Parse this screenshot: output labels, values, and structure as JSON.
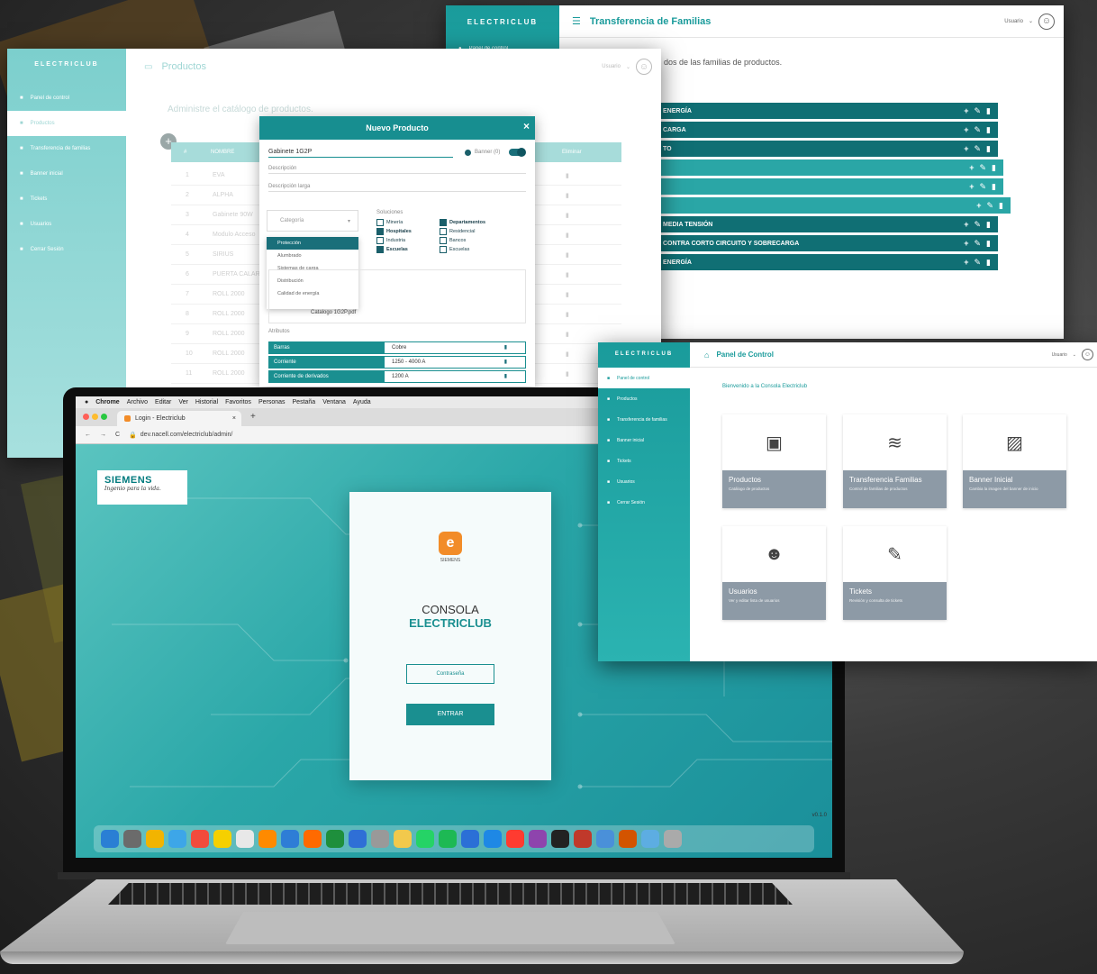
{
  "colors": {
    "teal": "#1a9b9b",
    "dark_teal": "#106f74",
    "card_gray": "#8d9aa6",
    "siemens": "#009999",
    "orange": "#f28c28"
  },
  "families_window": {
    "brand": "ELECTRICLUB",
    "title": "Transferencia de Familias",
    "user": "Usuario",
    "sidebar_first": "Panel de control",
    "subtitle": "dos de las familias de productos.",
    "rows": [
      "ENERGÍA",
      "CARGA",
      "TO",
      "",
      "",
      "",
      "MEDIA TENSIÓN",
      "CONTRA CORTO CIRCUITO Y SOBRECARGA",
      "ENERGÍA"
    ],
    "actions": "+ ✎ 🗑"
  },
  "products_window": {
    "brand": "ELECTRICLUB",
    "title": "Productos",
    "user": "Usuario",
    "subtitle": "Administre el catálogo de productos.",
    "sidebar": [
      "Panel de control",
      "Productos",
      "Transferencia de familias",
      "Banner inicial",
      "Tickets",
      "Usuarios",
      "Cerrar Sesión"
    ],
    "table_headers": [
      "#",
      "NOMBRE",
      "Editar",
      "Eliminar"
    ],
    "rows": [
      {
        "n": "1",
        "name": "EVA"
      },
      {
        "n": "2",
        "name": "ALPHA"
      },
      {
        "n": "3",
        "name": "Gabinete 90W"
      },
      {
        "n": "4",
        "name": "Modulo Acceso"
      },
      {
        "n": "5",
        "name": "SIRIUS"
      },
      {
        "n": "6",
        "name": "PUERTA CALAR"
      },
      {
        "n": "7",
        "name": "ROLL 2000"
      },
      {
        "n": "8",
        "name": "ROLL 2000"
      },
      {
        "n": "9",
        "name": "ROLL 2000"
      },
      {
        "n": "10",
        "name": "ROLL 2000"
      },
      {
        "n": "11",
        "name": "ROLL 2000"
      }
    ]
  },
  "modal": {
    "title": "Nuevo Producto",
    "close": "×",
    "name_value": "Gabinete 1G2P",
    "toggle_label": "Banner (0)",
    "description": "Descripción",
    "long_description": "Descripción larga",
    "category_placeholder": "Categoría",
    "category_options": [
      "Protección",
      "Alumbrado",
      "Sistemas de carga",
      "Distribución",
      "Calidad de energía"
    ],
    "solutions_label": "Soluciones",
    "solutions": [
      {
        "label": "Minería",
        "checked": false
      },
      {
        "label": "Departamentos",
        "checked": true
      },
      {
        "label": "Hospitales",
        "checked": true
      },
      {
        "label": "Residencial",
        "checked": false
      },
      {
        "label": "Industria",
        "checked": false
      },
      {
        "label": "Bancos",
        "checked": false
      },
      {
        "label": "Escuelas",
        "checked": true
      },
      {
        "label": "Escuelas",
        "checked": false
      }
    ],
    "catalog_label": "Catalogo 1G2P.pdf",
    "attributes_label": "Atributos",
    "attributes": [
      {
        "key": "Barras",
        "value": "Cobre"
      },
      {
        "key": "Corriente",
        "value": "1250 - 4000 A"
      },
      {
        "key": "Corriente de derivados",
        "value": "1200 A"
      }
    ]
  },
  "laptop": {
    "menu": [
      "Chrome",
      "Archivo",
      "Editar",
      "Ver",
      "Historial",
      "Favoritos",
      "Personas",
      "Pestaña",
      "Ventana",
      "Ayuda"
    ],
    "tab_title": "Login - Electriclub",
    "url": "dev.nacell.com/electriclub/admin/",
    "siemens_logo": "SIEMENS",
    "siemens_tagline": "Ingenio para la vida.",
    "card_logo_caption": "SIEMENS",
    "console_line1": "CONSOLA",
    "console_line2": "ELECTRICLUB",
    "password_placeholder": "Contraseña",
    "enter_button": "ENTRAR",
    "version": "v0.1.0",
    "dock_colors": [
      "#2a7fd4",
      "#6b6b6b",
      "#f2b400",
      "#3da6e8",
      "#f24b3c",
      "#f5d000",
      "#e8e8e8",
      "#ff8a00",
      "#2e7dd6",
      "#ff6a00",
      "#1e8f3c",
      "#2f6fd6",
      "#999999",
      "#f2c94c",
      "#25d366",
      "#1db954",
      "#2b6fd6",
      "#1e88e5",
      "#ff3b30",
      "#8e44ad",
      "#222222",
      "#c0392b",
      "#4a90d9",
      "#d35400",
      "#5dade2",
      "#aaaaaa"
    ]
  },
  "dashboard": {
    "brand": "ELECTRICLUB",
    "title": "Panel de Control",
    "user": "Usuario",
    "welcome": "Bienvenido a la Consola Electriclub",
    "sidebar": [
      "Panel de control",
      "Productos",
      "Transferencia de familias",
      "Banner inicial",
      "Tickets",
      "Usuarios",
      "Cerrar Sesión"
    ],
    "cards": [
      {
        "title": "Productos",
        "sub": "Catálogo de productos",
        "icon": "box-icon"
      },
      {
        "title": "Transferencia Familias",
        "sub": "Control de familias de productos",
        "icon": "layers-icon"
      },
      {
        "title": "Banner Inicial",
        "sub": "Cambia la imagen del banner de inicio",
        "icon": "image-icon"
      },
      {
        "title": "Usuarios",
        "sub": "Ver y editar lista de usuarios",
        "icon": "users-icon"
      },
      {
        "title": "Tickets",
        "sub": "Revisión y consulta de tickets",
        "icon": "ticket-icon"
      }
    ]
  }
}
